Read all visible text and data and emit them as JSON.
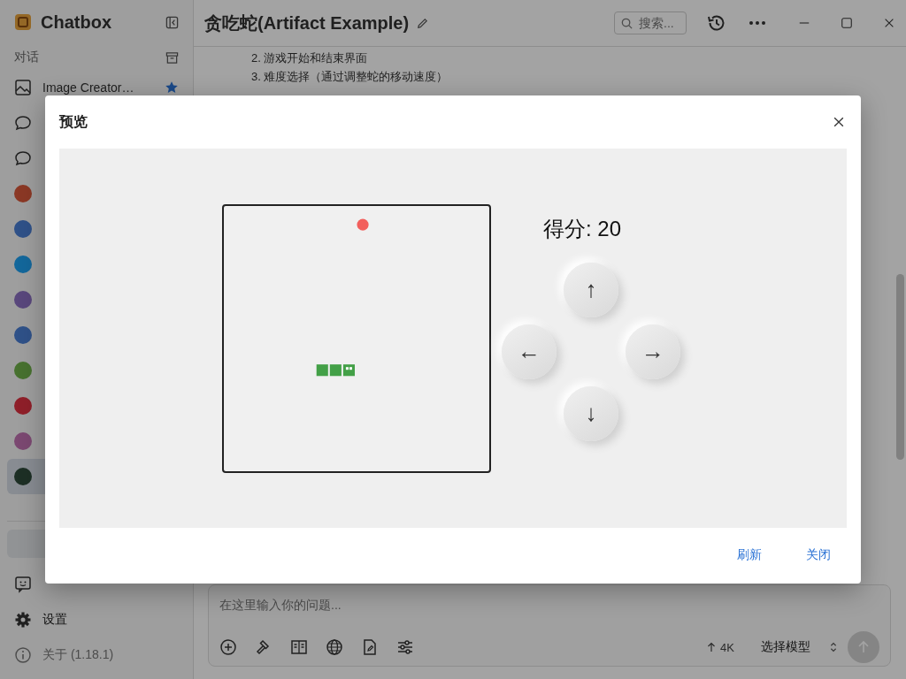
{
  "app": {
    "name": "Chatbox"
  },
  "sidebar": {
    "section_label": "对话",
    "items": [
      {
        "label": "Image Creator…",
        "kind": "image",
        "starred": true,
        "selected": false
      },
      {
        "kind": "chat",
        "starred": false,
        "selected": false
      },
      {
        "kind": "chat",
        "starred": false,
        "selected": false
      },
      {
        "kind": "avatar",
        "color": "#8b3825",
        "starred": false,
        "selected": false
      },
      {
        "kind": "avatar",
        "color": "#2f5188",
        "starred": false,
        "selected": false
      },
      {
        "kind": "avatar",
        "color": "#13679b",
        "starred": false,
        "selected": false
      },
      {
        "kind": "avatar",
        "color": "#59477c",
        "starred": false,
        "selected": false
      },
      {
        "kind": "avatar",
        "color": "#2f5188",
        "starred": false,
        "selected": false
      },
      {
        "kind": "avatar",
        "color": "#47712f",
        "starred": false,
        "selected": false
      },
      {
        "kind": "avatar",
        "color": "#8f1f29",
        "starred": false,
        "selected": false
      },
      {
        "kind": "avatar",
        "color": "#7b4871",
        "starred": false,
        "selected": false
      },
      {
        "kind": "avatar",
        "color": "#1d2f25",
        "starred": false,
        "selected": true
      }
    ],
    "settings": "设置",
    "about": "关于 (1.18.1)"
  },
  "header": {
    "title": "贪吃蛇(Artifact Example)",
    "search_placeholder": "搜索..."
  },
  "message_lines": [
    "2. 游戏开始和结束界面",
    "3. 难度选择（通过调整蛇的移动速度）"
  ],
  "composer": {
    "placeholder": "在这里输入你的问题...",
    "token_count": "4K",
    "model_select": "选择模型"
  },
  "dialog": {
    "title": "预览",
    "score": "得分: 20",
    "controls": [
      {
        "label": "↑",
        "kind": "up"
      },
      {
        "label": "←",
        "kind": "left"
      },
      {
        "label": "→",
        "kind": "right"
      },
      {
        "label": "↓",
        "kind": "down"
      }
    ],
    "buttons": [
      "刷新",
      "关闭"
    ]
  }
}
